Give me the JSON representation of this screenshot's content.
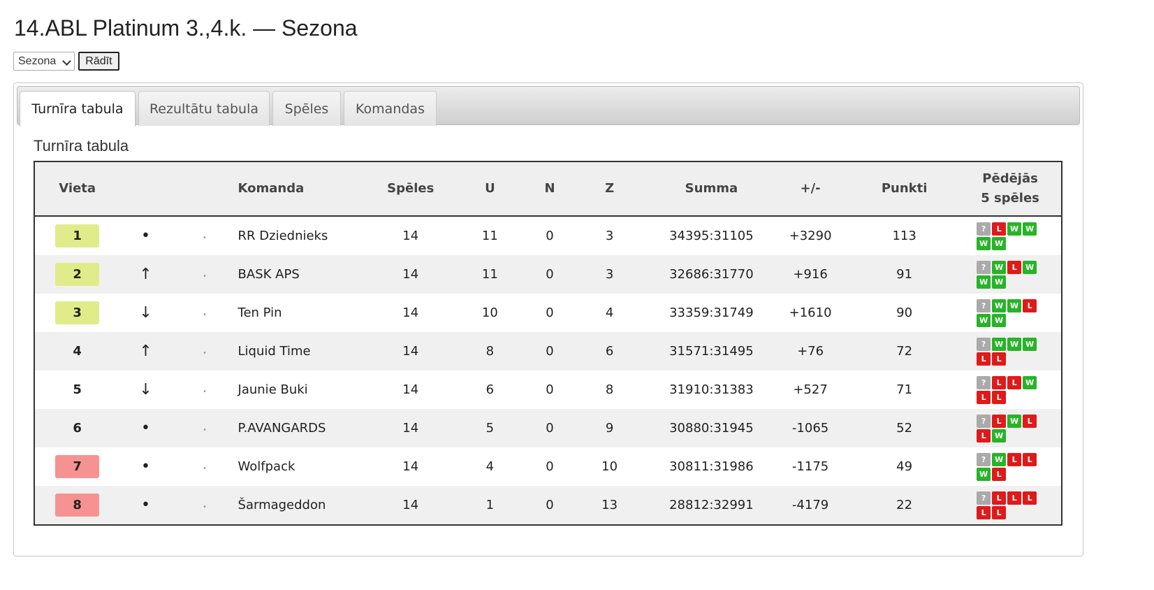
{
  "page": {
    "title": "14.ABL Platinum 3.,4.k. — Sezona",
    "season_select_value": "Sezona",
    "show_button": "Rādīt"
  },
  "tabs": [
    {
      "label": "Turnīra tabula",
      "active": true
    },
    {
      "label": "Rezultātu tabula",
      "active": false
    },
    {
      "label": "Spēles",
      "active": false
    },
    {
      "label": "Komandas",
      "active": false
    }
  ],
  "section_title": "Turnīra tabula",
  "table": {
    "headers": {
      "place": "Vieta",
      "team": "Komanda",
      "games": "Spēles",
      "wins": "U",
      "draws": "N",
      "losses": "Z",
      "sum": "Summa",
      "diff": "+/-",
      "points": "Punkti",
      "last5_line1": "Pēdējās",
      "last5_line2": "5 spēles"
    },
    "rows": [
      {
        "place": "1",
        "move": "•",
        "team": "RR Dziednieks",
        "games": "14",
        "wins": "11",
        "draws": "0",
        "losses": "3",
        "sum": "34395:31105",
        "diff": "+3290",
        "points": "113",
        "zone": "top",
        "form": [
          "?",
          "L",
          "W",
          "W",
          "W",
          "W"
        ]
      },
      {
        "place": "2",
        "move": "↑",
        "team": "BASK APS",
        "games": "14",
        "wins": "11",
        "draws": "0",
        "losses": "3",
        "sum": "32686:31770",
        "diff": "+916",
        "points": "91",
        "zone": "top",
        "form": [
          "?",
          "W",
          "L",
          "W",
          "W",
          "W"
        ]
      },
      {
        "place": "3",
        "move": "↓",
        "team": "Ten Pin",
        "games": "14",
        "wins": "10",
        "draws": "0",
        "losses": "4",
        "sum": "33359:31749",
        "diff": "+1610",
        "points": "90",
        "zone": "top",
        "form": [
          "?",
          "W",
          "W",
          "L",
          "W",
          "W"
        ]
      },
      {
        "place": "4",
        "move": "↑",
        "team": "Liquid Time",
        "games": "14",
        "wins": "8",
        "draws": "0",
        "losses": "6",
        "sum": "31571:31495",
        "diff": "+76",
        "points": "72",
        "zone": "none",
        "form": [
          "?",
          "W",
          "W",
          "W",
          "L",
          "L"
        ]
      },
      {
        "place": "5",
        "move": "↓",
        "team": "Jaunie Buki",
        "games": "14",
        "wins": "6",
        "draws": "0",
        "losses": "8",
        "sum": "31910:31383",
        "diff": "+527",
        "points": "71",
        "zone": "none",
        "form": [
          "?",
          "L",
          "L",
          "W",
          "L",
          "L"
        ]
      },
      {
        "place": "6",
        "move": "•",
        "team": "P.AVANGARDS",
        "games": "14",
        "wins": "5",
        "draws": "0",
        "losses": "9",
        "sum": "30880:31945",
        "diff": "-1065",
        "points": "52",
        "zone": "none",
        "form": [
          "?",
          "L",
          "W",
          "L",
          "L",
          "W"
        ]
      },
      {
        "place": "7",
        "move": "•",
        "team": "Wolfpack",
        "games": "14",
        "wins": "4",
        "draws": "0",
        "losses": "10",
        "sum": "30811:31986",
        "diff": "-1175",
        "points": "49",
        "zone": "bottom",
        "form": [
          "?",
          "W",
          "L",
          "L",
          "W",
          "L"
        ]
      },
      {
        "place": "8",
        "move": "•",
        "team": "Šarmageddon",
        "games": "14",
        "wins": "1",
        "draws": "0",
        "losses": "13",
        "sum": "28812:32991",
        "diff": "-4179",
        "points": "22",
        "zone": "bottom",
        "form": [
          "?",
          "L",
          "L",
          "L",
          "L",
          "L"
        ]
      }
    ]
  },
  "colors": {
    "top_zone": "#e0ec8a",
    "bottom_zone": "#f79292",
    "win": "#27b427",
    "loss": "#e01a1a",
    "unknown": "#aaaaaa"
  }
}
